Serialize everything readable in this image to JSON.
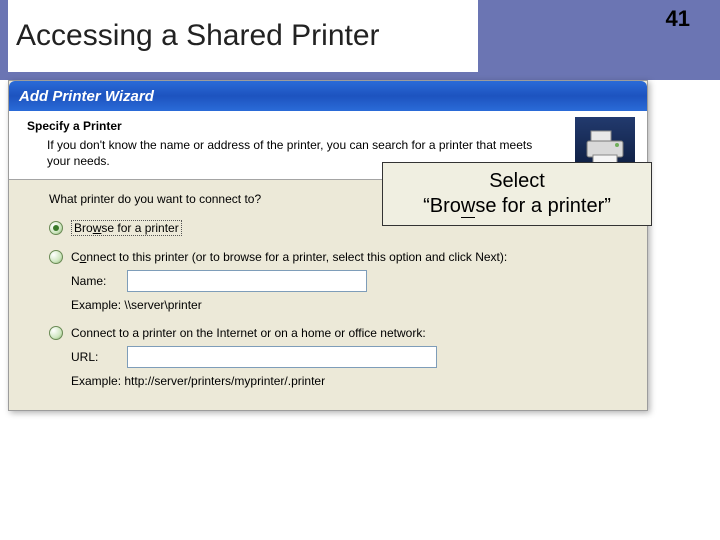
{
  "slide": {
    "title": "Accessing a Shared Printer",
    "page_number": "41"
  },
  "wizard": {
    "titlebar": "Add Printer Wizard",
    "header": {
      "heading": "Specify a Printer",
      "sub": "If you don't know the name or address of the printer, you can search for a printer that meets your needs."
    },
    "prompt": "What printer do you want to connect to?",
    "options": {
      "browse": {
        "label_pre": "Bro",
        "label_u": "w",
        "label_post": "se for a printer"
      },
      "connect_named": {
        "label_pre": "C",
        "label_u": "o",
        "label_post": "nnect to this printer (or to browse for a printer, select this option and click Next):",
        "name_label": "Name:",
        "name_value": "",
        "example": "Example: \\\\server\\printer"
      },
      "connect_internet": {
        "label_pre": "Connect to a printer on the Internet or on a home or office network",
        "label_u": ":",
        "url_label": "URL:",
        "url_value": "",
        "example": "Example: http://server/printers/myprinter/.printer"
      }
    }
  },
  "callout": {
    "line1_pre": "Select",
    "line2_pre": "“Bro",
    "line2_u": "w",
    "line2_post": "se for a printer”"
  }
}
